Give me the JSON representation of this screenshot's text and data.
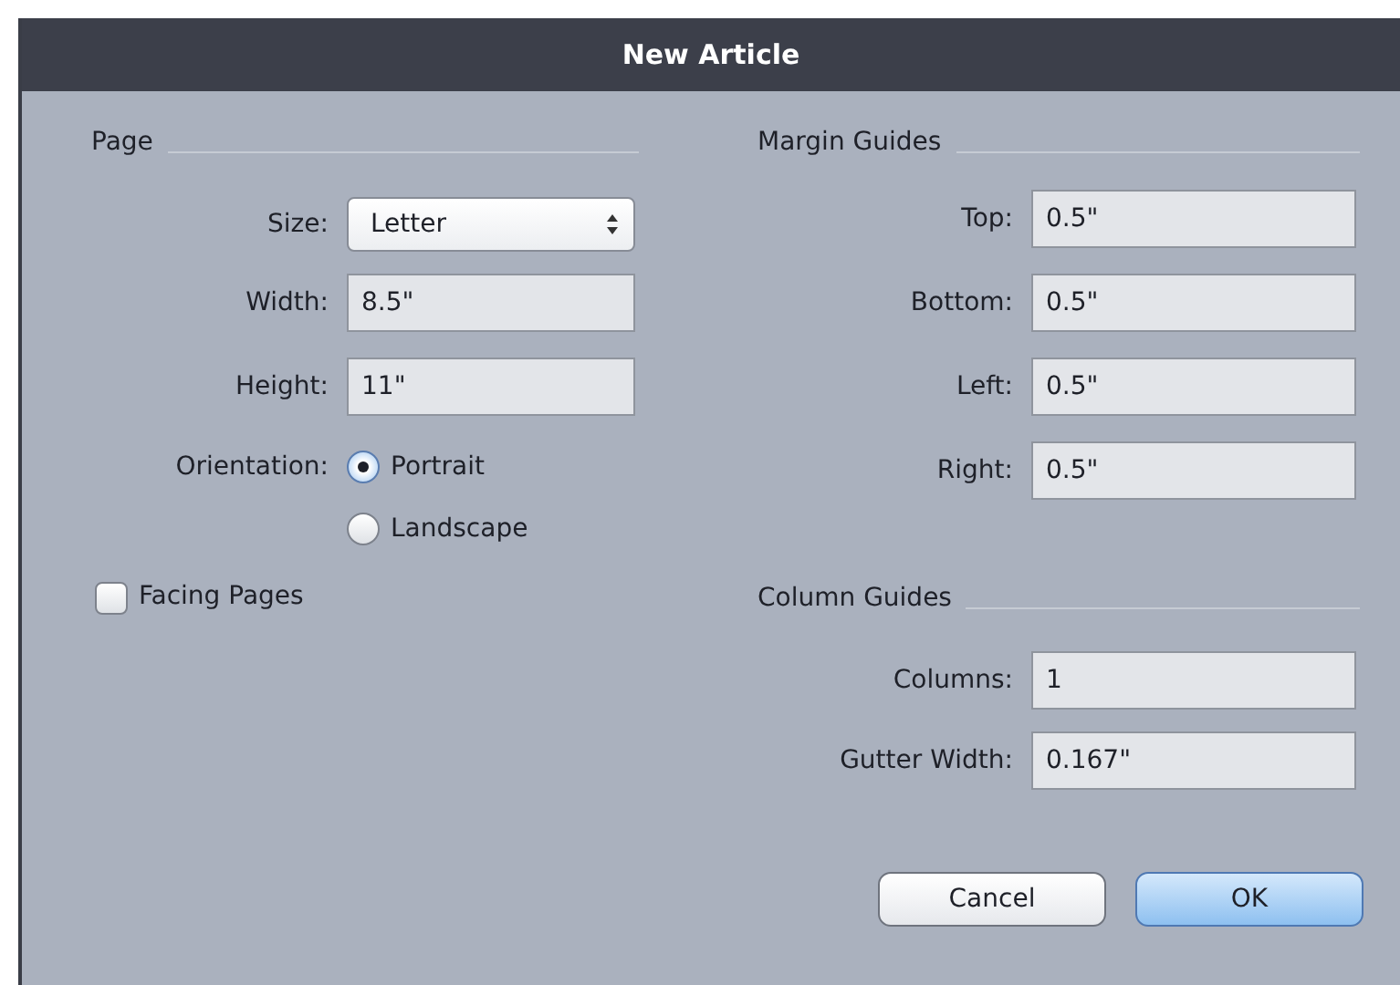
{
  "window": {
    "title": "New Article"
  },
  "page": {
    "heading": "Page",
    "fields": [
      {
        "kind": "select",
        "label": "Size:",
        "value": "Letter"
      },
      {
        "kind": "text",
        "label": "Width:",
        "value": "8.5\""
      },
      {
        "kind": "text",
        "label": "Height:",
        "value": "11\""
      }
    ],
    "orientation": {
      "label": "Orientation:",
      "options": [
        {
          "label": "Portrait",
          "selected": true
        },
        {
          "label": "Landscape",
          "selected": false
        }
      ]
    },
    "facing_pages": {
      "label": "Facing Pages",
      "checked": false
    }
  },
  "margin_guides": {
    "heading": "Margin Guides",
    "fields": [
      {
        "label": "Top:",
        "value": "0.5\""
      },
      {
        "label": "Bottom:",
        "value": "0.5\""
      },
      {
        "label": "Left:",
        "value": "0.5\""
      },
      {
        "label": "Right:",
        "value": "0.5\""
      }
    ]
  },
  "column_guides": {
    "heading": "Column Guides",
    "fields": [
      {
        "label": "Columns:",
        "value": "1"
      },
      {
        "label": "Gutter Width:",
        "value": "0.167\""
      }
    ]
  },
  "buttons": [
    {
      "label": "Cancel",
      "default": false
    },
    {
      "label": "OK",
      "default": true
    }
  ]
}
